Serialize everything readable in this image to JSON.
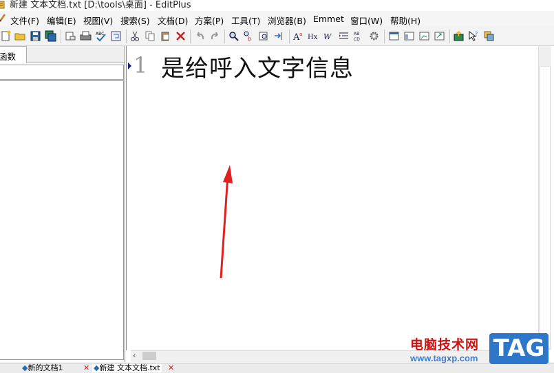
{
  "window": {
    "title": "新建 文本文档.txt [D:\\tools\\桌面] - EditPlus"
  },
  "menu": [
    {
      "label": "文件(F)",
      "name": "file"
    },
    {
      "label": "编辑(E)",
      "name": "edit"
    },
    {
      "label": "视图(V)",
      "name": "view"
    },
    {
      "label": "搜索(S)",
      "name": "search"
    },
    {
      "label": "文档(D)",
      "name": "document"
    },
    {
      "label": "方案(P)",
      "name": "project"
    },
    {
      "label": "工具(T)",
      "name": "tools"
    },
    {
      "label": "浏览器(B)",
      "name": "browser"
    },
    {
      "label": "Emmet",
      "name": "emmet"
    },
    {
      "label": "窗口(W)",
      "name": "window"
    },
    {
      "label": "帮助(H)",
      "name": "help"
    }
  ],
  "sidebar": {
    "tab_label": "函数"
  },
  "editor": {
    "line_number": "1",
    "line_text": "是给呼入文字信息"
  },
  "doc_tabs": [
    {
      "label": "新的文档1"
    },
    {
      "label": "新建 文本文档.txt"
    }
  ],
  "watermark": {
    "site_name": "电脑技术网",
    "url": "www.tagxp.com",
    "tag": "TAG"
  },
  "colors": {
    "annotation_arrow": "#e02020",
    "watermark_red": "#cc1111",
    "watermark_blue": "#2d76c9"
  }
}
